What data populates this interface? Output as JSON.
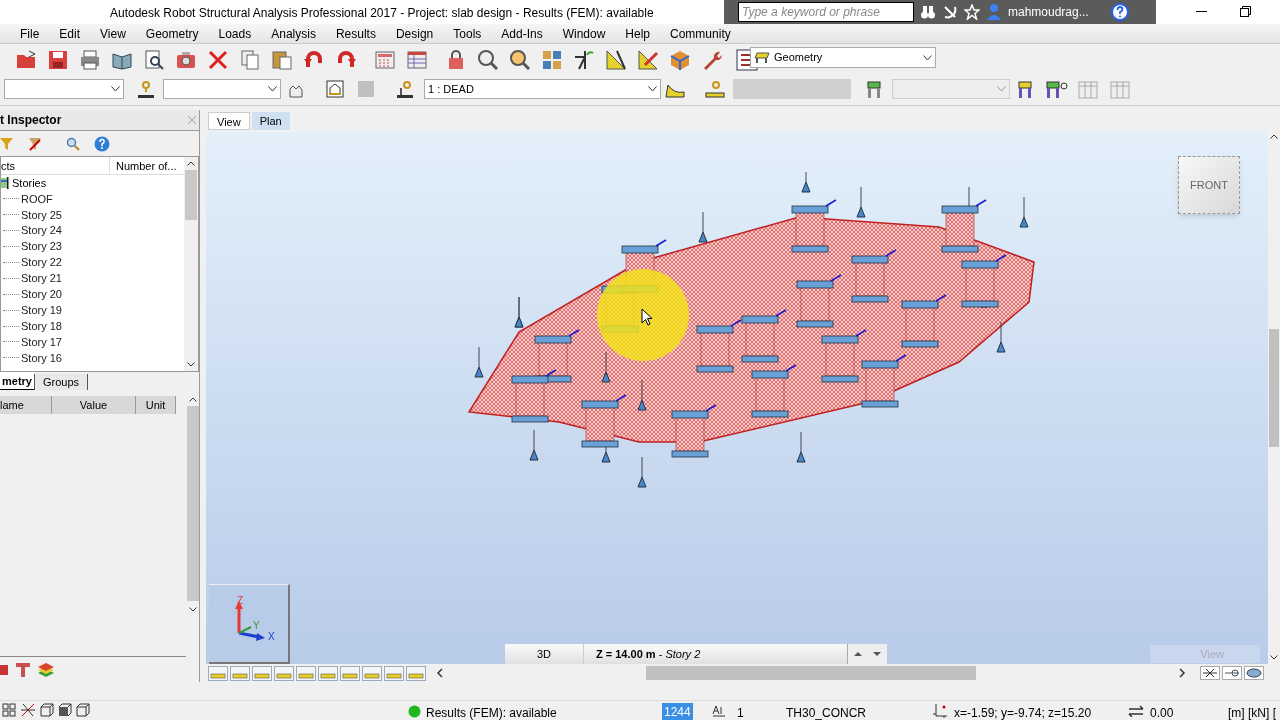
{
  "window": {
    "title": "Autodesk Robot Structural Analysis Professional 2017 - Project: slab design - Results (FEM): available"
  },
  "title_bar": {
    "search": {
      "placeholder": "Type a keyword or phrase"
    },
    "user": "mahmoudrag..."
  },
  "menu": [
    {
      "label": "File"
    },
    {
      "label": "Edit"
    },
    {
      "label": "View"
    },
    {
      "label": "Geometry"
    },
    {
      "label": "Loads"
    },
    {
      "label": "Analysis"
    },
    {
      "label": "Results"
    },
    {
      "label": "Design"
    },
    {
      "label": "Tools"
    },
    {
      "label": "Add-Ins"
    },
    {
      "label": "Window"
    },
    {
      "label": "Help"
    },
    {
      "label": "Community"
    }
  ],
  "layout_dropdown": "Geometry",
  "load_case_dropdown": "1 : DEAD",
  "inspector": {
    "title": "t Inspector",
    "columns": [
      "cts",
      "Number of..."
    ],
    "tree": [
      {
        "label": "Stories",
        "expanded": true,
        "children": [
          {
            "label": "ROOF"
          },
          {
            "label": "Story 25"
          },
          {
            "label": "Story 24"
          },
          {
            "label": "Story 23"
          },
          {
            "label": "Story 22"
          },
          {
            "label": "Story 21"
          },
          {
            "label": "Story 20"
          },
          {
            "label": "Story 19"
          },
          {
            "label": "Story 18"
          },
          {
            "label": "Story 17"
          },
          {
            "label": "Story 16"
          }
        ]
      }
    ],
    "tabs": [
      {
        "label": "metry",
        "selected": true
      },
      {
        "label": "Groups",
        "selected": false
      }
    ],
    "properties_columns": [
      "lame",
      "Value",
      "Unit"
    ]
  },
  "viewport": {
    "tabs": [
      {
        "label": "View",
        "selected": true
      },
      {
        "label": "Plan",
        "selected": false
      }
    ],
    "view_cube": "FRONT",
    "axes": [
      "Z",
      "Y",
      "X"
    ],
    "mode": "3D",
    "story": "**Z = 14.00 m** - *Story 2*",
    "corner_label": "View"
  },
  "status_bar": {
    "results": "Results (FEM): available",
    "results_ok": true,
    "selection": "1244",
    "case_number": "1",
    "material": "TH30_CONCR",
    "coordinates": "x=-1.59; y=-9.74; z=15.20",
    "angle": "0.00",
    "units": "[m] [kN] ["
  }
}
